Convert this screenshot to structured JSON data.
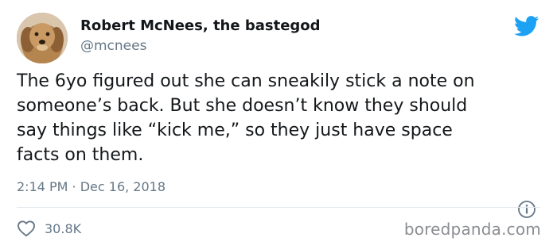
{
  "author": {
    "display_name": "Robert McNees, the bastegod",
    "handle": "@mcnees",
    "avatar_icon": "dog-avatar"
  },
  "tweet": {
    "text_lines": [
      "The 6yo figured out she can sneakily stick a note on",
      "someone’s back. But she doesn’t know they should",
      "say things like “kick me,” so they just have space",
      "facts on them."
    ],
    "timestamp": "2:14 PM · Dec 16, 2018"
  },
  "actions": {
    "like_count": "30.8K",
    "like_icon": "heart-icon",
    "info_icon": "info-icon"
  },
  "brand": {
    "logo_icon": "twitter-bird-icon",
    "color": "#1da1f2"
  },
  "watermark": "boredpanda.com"
}
